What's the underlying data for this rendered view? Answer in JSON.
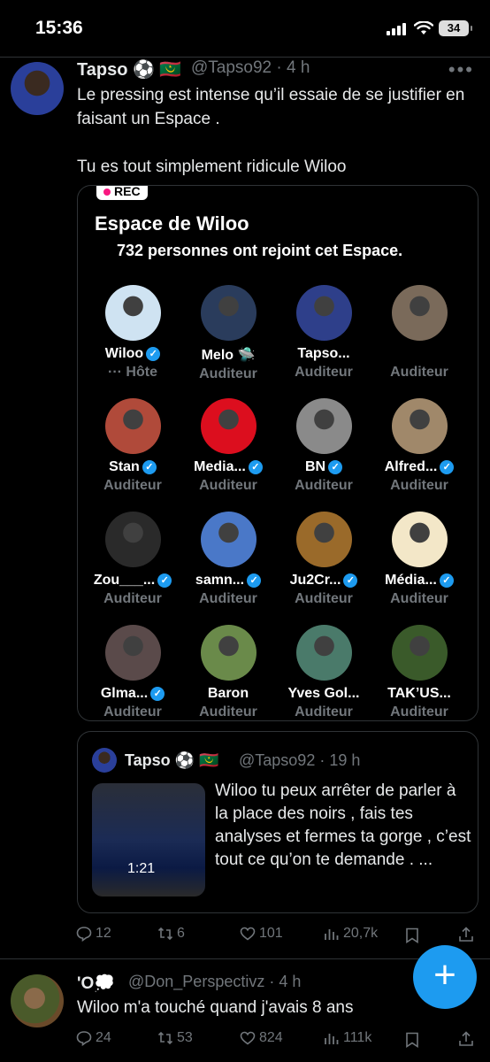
{
  "status": {
    "time": "15:36",
    "battery": "34"
  },
  "tweet1": {
    "name": "Tapso ⚽ 🇲🇷",
    "handle": "@Tapso92 · 4 h",
    "text": "Le pressing est intense qu’il essaie de se justifier en faisant un Espace .\n\nTu es tout simplement ridicule Wiloo",
    "space": {
      "rec": "REC",
      "title": "Espace de Wiloo",
      "count": "732 personnes ont rejoint cet Espace.",
      "members": [
        {
          "name": "Wiloo",
          "role": "··· Hôte",
          "verified": true,
          "color": "#cfe3f2"
        },
        {
          "name": "Melo 🛸",
          "role": "Auditeur",
          "verified": false,
          "color": "#2a3c5c"
        },
        {
          "name": "Tapso...",
          "role": "Auditeur",
          "verified": false,
          "color": "#2e3f8a"
        },
        {
          "name": " ",
          "role": "Auditeur",
          "verified": false,
          "color": "#7a6a5a"
        },
        {
          "name": "Stan",
          "role": "Auditeur",
          "verified": true,
          "color": "#b04a3a"
        },
        {
          "name": "Media...",
          "role": "Auditeur",
          "verified": true,
          "color": "#dc0e1e"
        },
        {
          "name": "BN",
          "role": "Auditeur",
          "verified": true,
          "color": "#8a8a8a"
        },
        {
          "name": "Alfred...",
          "role": "Auditeur",
          "verified": true,
          "color": "#a0886a"
        },
        {
          "name": "Zou___...",
          "role": "Auditeur",
          "verified": true,
          "color": "#2a2a2a"
        },
        {
          "name": "samn...",
          "role": "Auditeur",
          "verified": true,
          "color": "#4a78c8"
        },
        {
          "name": "Ju2Cr...",
          "role": "Auditeur",
          "verified": true,
          "color": "#9a6a2a"
        },
        {
          "name": "Média...",
          "role": "Auditeur",
          "verified": true,
          "color": "#f3e7c8"
        },
        {
          "name": "Glma...",
          "role": "Auditeur",
          "verified": true,
          "color": "#5a4a4a"
        },
        {
          "name": "Baron",
          "role": "Auditeur",
          "verified": false,
          "color": "#6a8a4a"
        },
        {
          "name": "Yves Gol...",
          "role": "Auditeur",
          "verified": false,
          "color": "#4a7a6a"
        },
        {
          "name": "TAK’US...",
          "role": "Auditeur",
          "verified": false,
          "color": "#3a5a2a"
        }
      ]
    },
    "quote": {
      "name": "Tapso ⚽ 🇲🇷",
      "handle": "@Tapso92 · 19 h",
      "video_time": "1:21",
      "text": "Wiloo tu peux arrêter de parler à la place des noirs , fais tes analyses et fermes ta gorge , c’est tout ce qu’on te demande . ..."
    },
    "actions": {
      "replies": "12",
      "retweets": "6",
      "likes": "101",
      "views": "20,7k"
    }
  },
  "tweet2": {
    "name": "'O💭",
    "handle": "@Don_Perspectivz · 4 h",
    "text": "Wiloo m'a touché quand j'avais 8 ans",
    "actions": {
      "replies": "24",
      "retweets": "53",
      "likes": "824",
      "views": "111k"
    }
  },
  "fab": {
    "label": "+"
  },
  "colors": {
    "accent": "#1d9bf0",
    "muted": "#71767b",
    "background": "#000000"
  }
}
